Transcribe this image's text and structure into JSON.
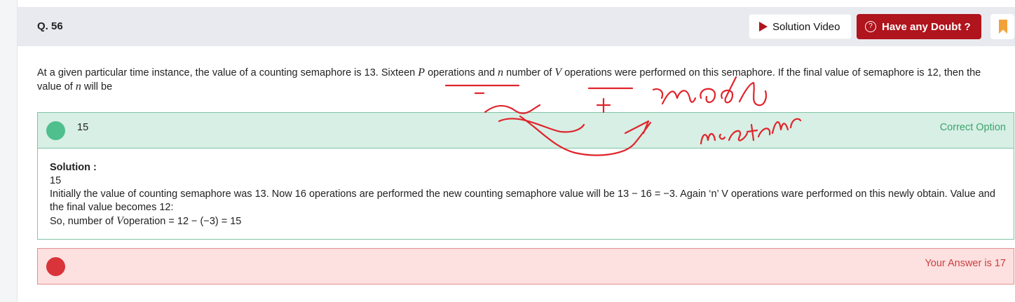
{
  "question": {
    "number": "Q. 56",
    "text_part1": "At a given particular time instance, the value of a counting semaphore is 13. Sixteen ",
    "var_p": "P",
    "text_part2": " operations and ",
    "var_n": "n",
    "text_part3": " number of ",
    "var_v": "V",
    "text_part4": " operations were performed on this semaphore. If the final value of semaphore is 12, then the value of ",
    "var_n2": "n",
    "text_part5": " will be"
  },
  "header": {
    "solution_video_label": "Solution Video",
    "doubt_label": "Have any Doubt ?",
    "doubt_icon_glyph": "?"
  },
  "correct_option": {
    "value": "15",
    "label": "Correct Option"
  },
  "solution": {
    "title": "Solution :",
    "answer": "15",
    "line1": "Initially the value of counting semaphore was 13. Now 16 operations are performed the new counting semaphore value will be 13 − 16 = −3. Again ‘n’ V operations ware performed on this newly obtain. Value and the final value becomes 12:",
    "line2_prefix": "So, number of ",
    "line2_var": "V",
    "line2_suffix": "operation = 12 − (−3) = 15"
  },
  "user_answer": {
    "label": "Your Answer is 17"
  },
  "colors": {
    "brand_red": "#b0141c",
    "correct_green": "#4fbf8d",
    "wrong_red": "#d8343a",
    "bookmark_orange": "#f3a23a",
    "annotation_ink": "#e0242b"
  },
  "annotation": {
    "handwritten_text": "made mistake"
  }
}
